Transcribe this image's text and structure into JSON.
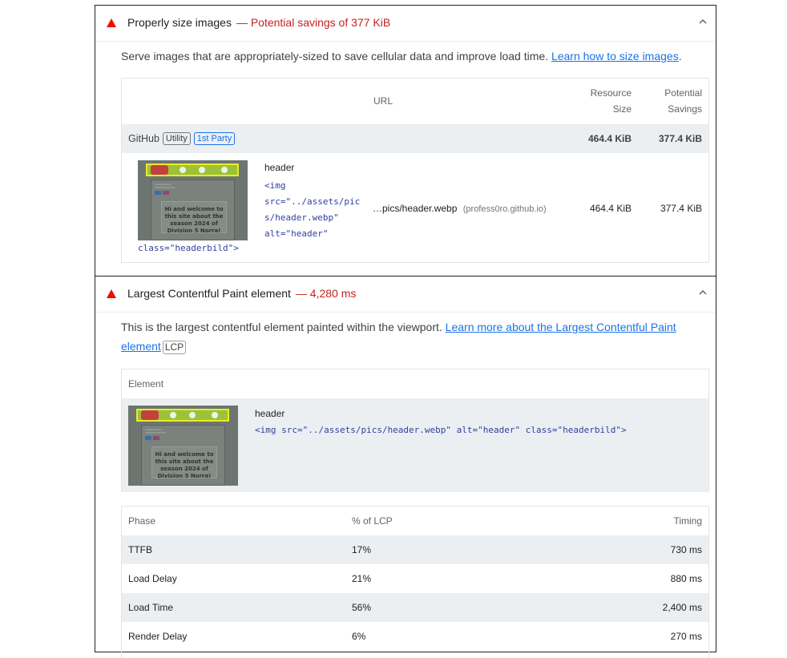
{
  "audit1": {
    "title": "Properly size images",
    "savings": "— Potential savings of 377 KiB",
    "description": "Serve images that are appropriately-sized to save cellular data and improve load time. ",
    "link": "Learn how to size images",
    "after_link": ".",
    "table": {
      "col_url": "URL",
      "col_resource_size": [
        "Resource",
        "Size"
      ],
      "col_savings": [
        "Potential",
        "Savings"
      ],
      "group": {
        "name": "GitHub",
        "chip_utility": "Utility",
        "chip_party": "1st Party",
        "resource_size": "464.4 KiB",
        "savings": "377.4 KiB"
      },
      "row": {
        "node_label": "header",
        "snippet_lines": [
          "<img",
          "src=\"../assets/pic",
          "s/header.webp\"",
          "alt=\"header\""
        ],
        "snippet_tail": "class=\"headerbild\">",
        "url": "…pics/header.webp",
        "host": "(profess0ro.github.io)",
        "resource_size": "464.4 KiB",
        "savings": "377.4 KiB"
      }
    }
  },
  "audit2": {
    "title": "Largest Contentful Paint element",
    "savings": "— 4,280 ms",
    "description": "This is the largest contentful element painted within the viewport. ",
    "link_line1": "Learn more about the Largest Contentful Paint",
    "link_line2": "element",
    "badge": "LCP",
    "element_table": {
      "header": "Element",
      "node_label": "header",
      "snippet": "<img src=\"../assets/pics/header.webp\" alt=\"header\" class=\"headerbild\">"
    },
    "phase_table": {
      "headers": [
        "Phase",
        "% of LCP",
        "Timing"
      ],
      "rows": [
        {
          "phase": "TTFB",
          "pct": "17%",
          "timing": "730 ms"
        },
        {
          "phase": "Load Delay",
          "pct": "21%",
          "timing": "880 ms"
        },
        {
          "phase": "Load Time",
          "pct": "56%",
          "timing": "2,400 ms"
        },
        {
          "phase": "Render Delay",
          "pct": "6%",
          "timing": "270 ms"
        }
      ]
    }
  },
  "thumbnail": {
    "caption": "Hi and welcome to this site about the season 2024 of Division 5 Norra!"
  },
  "colors": {
    "warn_red": "#eb0f00",
    "savings_red": "#c5221f",
    "link_blue": "#1a73e8",
    "code_blue": "#303f9f",
    "row_shade": "#eceff1"
  },
  "icons": {
    "fail": "warning-triangle-icon",
    "collapse": "chevron-up-icon"
  }
}
